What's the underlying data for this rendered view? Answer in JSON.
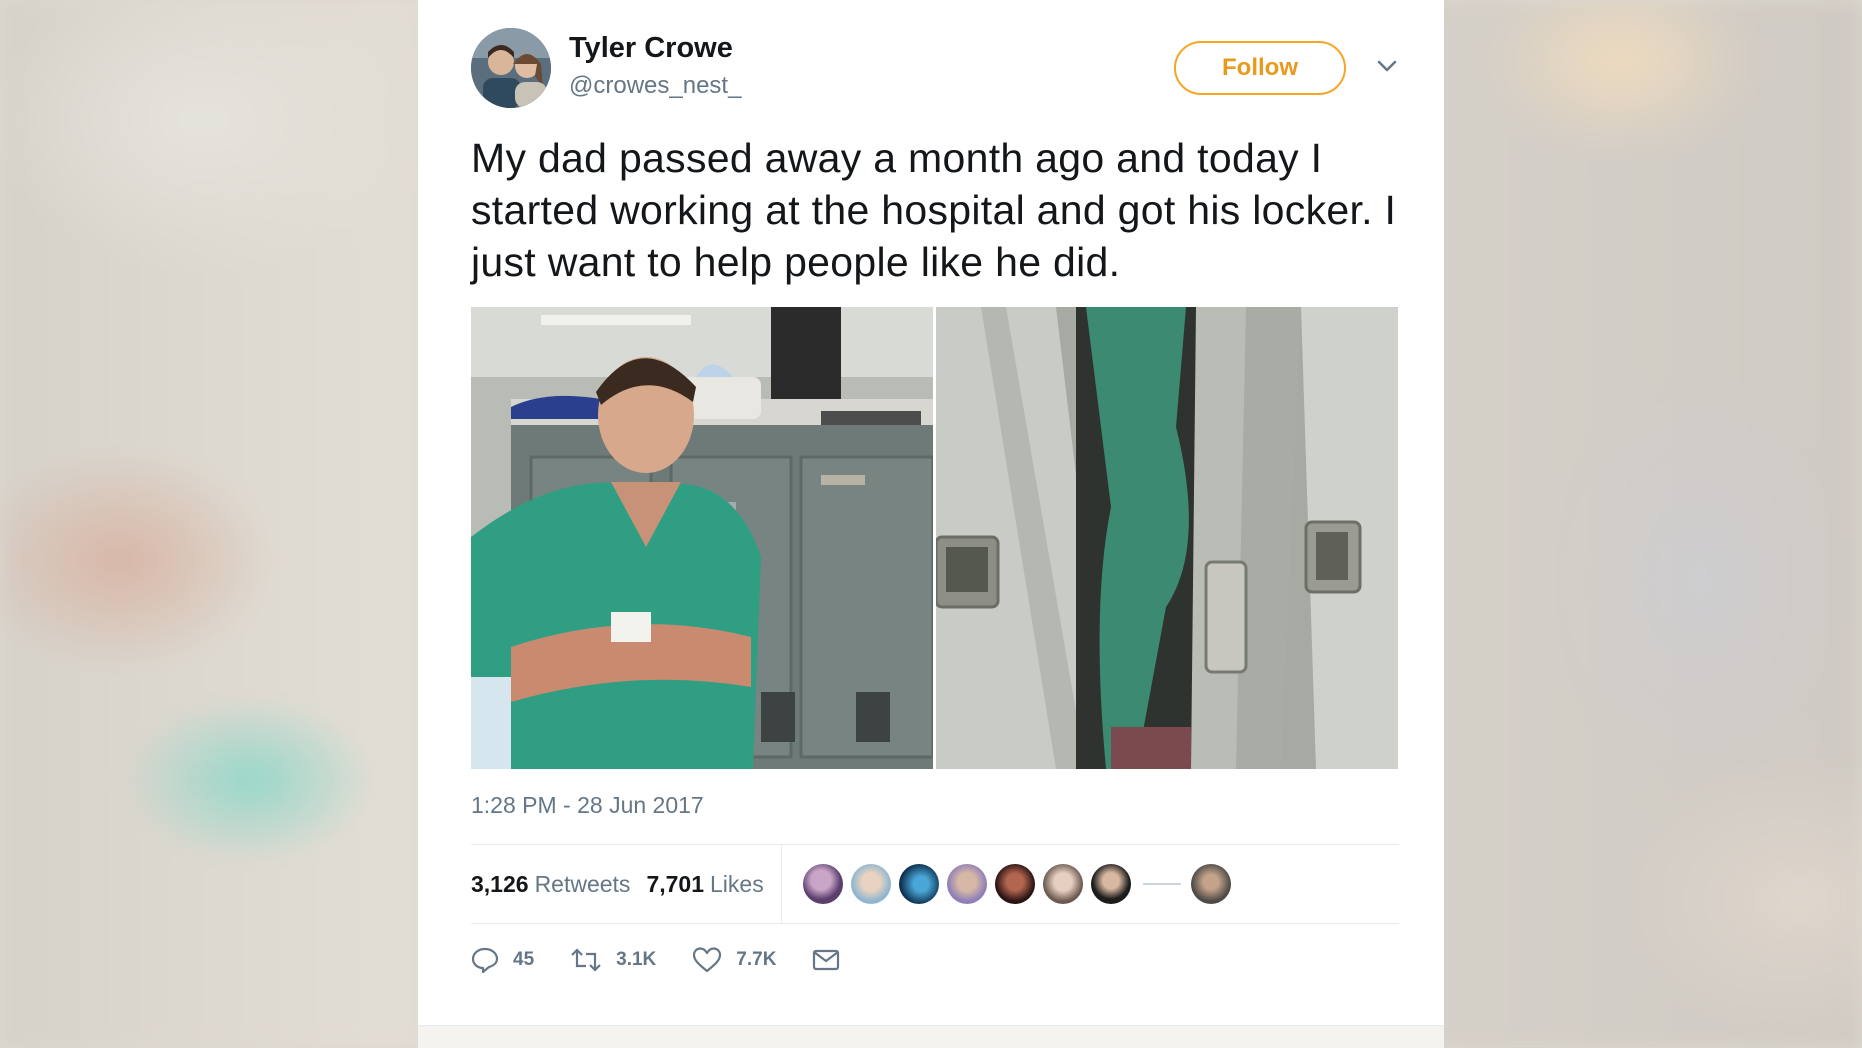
{
  "tweet": {
    "author": {
      "name": "Tyler Crowe",
      "handle": "@crowes_nest_"
    },
    "follow_label": "Follow",
    "text": "My dad passed away a month ago and today I started working at the hospital and got his locker. I just want to help people like he did.",
    "timestamp": "1:28 PM - 28 Jun 2017",
    "stats": {
      "retweets_count": "3,126",
      "retweets_label": "Retweets",
      "likes_count": "7,701",
      "likes_label": "Likes"
    },
    "actions": {
      "reply_count": "45",
      "retweet_count": "3.1K",
      "like_count": "7.7K"
    },
    "icons": [
      "chevron-down-icon",
      "reply-icon",
      "retweet-icon",
      "heart-icon",
      "envelope-icon"
    ],
    "colors": {
      "follow_accent": "#f5a623",
      "text": "#14171a",
      "muted": "#657786"
    }
  }
}
